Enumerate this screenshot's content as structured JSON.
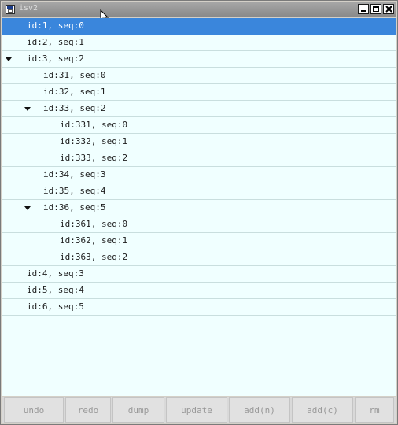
{
  "window": {
    "title": "isv2"
  },
  "tree": {
    "rows": [
      {
        "label": "id:1, seq:0",
        "depth": 0,
        "expanded": false,
        "has_children": false,
        "selected": true
      },
      {
        "label": "id:2, seq:1",
        "depth": 0,
        "expanded": false,
        "has_children": false,
        "selected": false
      },
      {
        "label": "id:3, seq:2",
        "depth": 0,
        "expanded": true,
        "has_children": true,
        "selected": false
      },
      {
        "label": "id:31, seq:0",
        "depth": 1,
        "expanded": false,
        "has_children": false,
        "selected": false
      },
      {
        "label": "id:32, seq:1",
        "depth": 1,
        "expanded": false,
        "has_children": false,
        "selected": false
      },
      {
        "label": "id:33, seq:2",
        "depth": 1,
        "expanded": true,
        "has_children": true,
        "selected": false
      },
      {
        "label": "id:331, seq:0",
        "depth": 2,
        "expanded": false,
        "has_children": false,
        "selected": false
      },
      {
        "label": "id:332, seq:1",
        "depth": 2,
        "expanded": false,
        "has_children": false,
        "selected": false
      },
      {
        "label": "id:333, seq:2",
        "depth": 2,
        "expanded": false,
        "has_children": false,
        "selected": false
      },
      {
        "label": "id:34, seq:3",
        "depth": 1,
        "expanded": false,
        "has_children": false,
        "selected": false
      },
      {
        "label": "id:35, seq:4",
        "depth": 1,
        "expanded": false,
        "has_children": false,
        "selected": false
      },
      {
        "label": "id:36, seq:5",
        "depth": 1,
        "expanded": true,
        "has_children": true,
        "selected": false
      },
      {
        "label": "id:361, seq:0",
        "depth": 2,
        "expanded": false,
        "has_children": false,
        "selected": false
      },
      {
        "label": "id:362, seq:1",
        "depth": 2,
        "expanded": false,
        "has_children": false,
        "selected": false
      },
      {
        "label": "id:363, seq:2",
        "depth": 2,
        "expanded": false,
        "has_children": false,
        "selected": false
      },
      {
        "label": "id:4, seq:3",
        "depth": 0,
        "expanded": false,
        "has_children": false,
        "selected": false
      },
      {
        "label": "id:5, seq:4",
        "depth": 0,
        "expanded": false,
        "has_children": false,
        "selected": false
      },
      {
        "label": "id:6, seq:5",
        "depth": 0,
        "expanded": false,
        "has_children": false,
        "selected": false
      }
    ]
  },
  "buttons": {
    "undo": "undo",
    "redo": "redo",
    "dump": "dump",
    "update": "update",
    "add_n": "add(n)",
    "add_c": "add(c)",
    "rm": "rm"
  },
  "colors": {
    "selection": "#3a86dc",
    "tree_background": "#f0ffff",
    "disabled_text": "#999999"
  }
}
